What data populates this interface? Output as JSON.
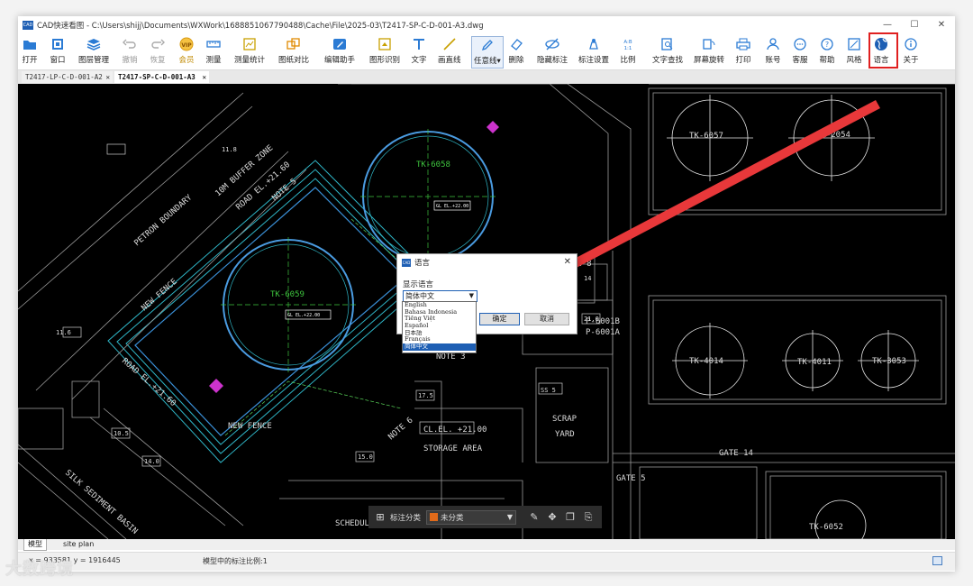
{
  "window": {
    "title": "CAD快速看图 - C:\\Users\\shijj\\Documents\\WXWork\\1688851067790488\\Cache\\File\\2025-03\\T2417-SP-C-D-001-A3.dwg",
    "app_icon_text": "CAD",
    "controls": {
      "minimize": "—",
      "maximize": "☐",
      "close": "✕"
    }
  },
  "ribbon": {
    "buttons": [
      {
        "label": "打开",
        "icon": "folder-icon",
        "enabled": true
      },
      {
        "label": "窗口",
        "icon": "window-icon",
        "enabled": true
      },
      {
        "label": "图层管理",
        "icon": "layers-icon",
        "enabled": true
      },
      {
        "label": "撤销",
        "icon": "undo-icon",
        "enabled": false
      },
      {
        "label": "恢复",
        "icon": "redo-icon",
        "enabled": false
      },
      {
        "label": "会员",
        "icon": "vip-icon",
        "enabled": true
      },
      {
        "label": "测量",
        "icon": "ruler-icon",
        "enabled": true
      },
      {
        "label": "测量统计",
        "icon": "measure-stats-icon",
        "enabled": true
      },
      {
        "label": "图纸对比",
        "icon": "compare-icon",
        "enabled": true
      },
      {
        "label": "编辑助手",
        "icon": "edit-assistant-icon",
        "enabled": true
      },
      {
        "label": "图形识别",
        "icon": "shape-recognize-icon",
        "enabled": true
      },
      {
        "label": "文字",
        "icon": "text-icon",
        "enabled": true
      },
      {
        "label": "画直线",
        "icon": "line-icon",
        "enabled": true
      },
      {
        "label": "任意线▾",
        "icon": "pen-icon",
        "enabled": true
      },
      {
        "label": "删除",
        "icon": "eraser-icon",
        "enabled": true
      },
      {
        "label": "隐藏标注",
        "icon": "hide-annotation-icon",
        "enabled": true
      },
      {
        "label": "标注设置",
        "icon": "annotation-settings-icon",
        "enabled": true
      },
      {
        "label": "比例",
        "icon": "scale-icon",
        "enabled": true
      },
      {
        "label": "文字查找",
        "icon": "text-search-icon",
        "enabled": true
      },
      {
        "label": "屏幕旋转",
        "icon": "rotate-screen-icon",
        "enabled": true
      },
      {
        "label": "打印",
        "icon": "printer-icon",
        "enabled": true
      },
      {
        "label": "账号",
        "icon": "user-icon",
        "enabled": true
      },
      {
        "label": "客服",
        "icon": "chat-icon",
        "enabled": true
      },
      {
        "label": "帮助",
        "icon": "help-icon",
        "enabled": true
      },
      {
        "label": "风格",
        "icon": "style-icon",
        "enabled": true
      },
      {
        "label": "语言",
        "icon": "globe-icon",
        "enabled": true
      },
      {
        "label": "关于",
        "icon": "info-icon",
        "enabled": true
      }
    ]
  },
  "doc_tabs": [
    {
      "label": "T2417-LP-C-D-001-A2",
      "close": "✕",
      "active": false
    },
    {
      "label": "T2417-SP-C-D-001-A3",
      "close": "✕",
      "active": true
    }
  ],
  "drawing": {
    "texts": {
      "tk6058": "TK-6058",
      "tk6059": "TK-6059",
      "tk6057": "TK-6057",
      "tk2054": "TK-2054",
      "tk4014": "TK-4014",
      "tk4011": "TK-4011",
      "tk3053": "TK-3053",
      "tk6052": "TK-6052",
      "petron": "PETRON BOUNDARY",
      "buffer": "10M BUFFER ZONE",
      "road1": "ROAD EL.+21.60",
      "road2": "ROAD EL.+21.60",
      "note5": "NOTE 5",
      "note8": "NOTE 8",
      "note3": "NOTE 3",
      "note6": "NOTE 6",
      "newfence1": "NEW FENCE",
      "newfence2": "NEW FENCE",
      "silk": "SILK SEDIMENT BASIN",
      "storage": "STORAGE AREA",
      "scrap1": "SCRAP",
      "scrap2": "YARD",
      "clel": "CL.EL. +21.00",
      "gate14": "GATE 14",
      "gate5": "GATE 5",
      "sched": "SCHEDULE",
      "p6001b": "P-6001B",
      "p6001a": "P-6001A",
      "gl1": "GL EL.+22.00",
      "gl2": "GL EL.+22.00",
      "ss5": "SS 5",
      "n116": "11.6",
      "n118": "11.8",
      "n105": "10.5",
      "n140": "14.0",
      "n150": "15.0",
      "n175": "17.5",
      "n216": "21.6",
      "n14": "14"
    }
  },
  "annotation_bar": {
    "grid_icon": "grid-icon",
    "label": "标注分类",
    "category_value": "未分类",
    "category_color": "#e06a1a",
    "tools": [
      "edit-icon",
      "move-icon",
      "copy-icon",
      "paste-icon"
    ]
  },
  "dialog": {
    "title": "语言",
    "close": "✕",
    "label": "显示语言",
    "selected": "简体中文",
    "options": [
      "English",
      "Bahasa Indonesia",
      "Tiếng Việt",
      "Español",
      "日本語",
      "Français",
      "简体中文"
    ],
    "ok_label": "确定",
    "cancel_label": "取消"
  },
  "layout_tabs": [
    {
      "label": "模型",
      "active": true
    },
    {
      "label": "site plan",
      "active": false
    }
  ],
  "status": {
    "coords": "x = 933581  y = 1916445",
    "scale_text": "模型中的标注比例:1"
  },
  "watermark": "大数跨境",
  "colors": {
    "highlight_red": "#e02020",
    "accent_blue": "#1e5fb4",
    "canvas_bg": "#000000",
    "cad_cyan": "#2fb7c8",
    "cad_green": "#3ec43e",
    "cad_blue": "#4a9be0"
  }
}
